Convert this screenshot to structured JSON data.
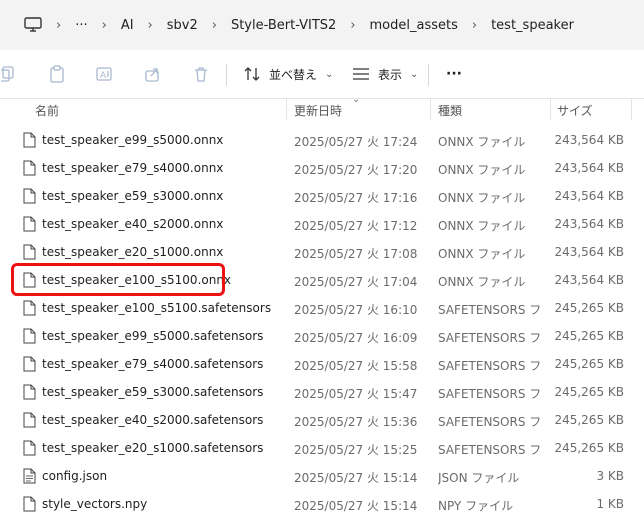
{
  "breadcrumb": {
    "items": [
      "AI",
      "sbv2",
      "Style-Bert-VITS2",
      "model_assets",
      "test_speaker"
    ],
    "more": "···"
  },
  "toolbar": {
    "sort_label": "並べ替え",
    "view_label": "表示",
    "more_label": "···"
  },
  "columns": {
    "name": "名前",
    "date": "更新日時",
    "type": "種類",
    "size": "サイズ"
  },
  "files": [
    {
      "name": "test_speaker_e99_s5000.onnx",
      "date": "2025/05/27 火 17:24",
      "type": "ONNX ファイル",
      "size": "243,564 KB"
    },
    {
      "name": "test_speaker_e79_s4000.onnx",
      "date": "2025/05/27 火 17:20",
      "type": "ONNX ファイル",
      "size": "243,564 KB"
    },
    {
      "name": "test_speaker_e59_s3000.onnx",
      "date": "2025/05/27 火 17:16",
      "type": "ONNX ファイル",
      "size": "243,564 KB"
    },
    {
      "name": "test_speaker_e40_s2000.onnx",
      "date": "2025/05/27 火 17:12",
      "type": "ONNX ファイル",
      "size": "243,564 KB"
    },
    {
      "name": "test_speaker_e20_s1000.onnx",
      "date": "2025/05/27 火 17:08",
      "type": "ONNX ファイル",
      "size": "243,564 KB"
    },
    {
      "name": "test_speaker_e100_s5100.onnx",
      "date": "2025/05/27 火 17:04",
      "type": "ONNX ファイル",
      "size": "243,564 KB"
    },
    {
      "name": "test_speaker_e100_s5100.safetensors",
      "date": "2025/05/27 火 16:10",
      "type": "SAFETENSORS ファ...",
      "size": "245,265 KB"
    },
    {
      "name": "test_speaker_e99_s5000.safetensors",
      "date": "2025/05/27 火 16:09",
      "type": "SAFETENSORS ファ...",
      "size": "245,265 KB"
    },
    {
      "name": "test_speaker_e79_s4000.safetensors",
      "date": "2025/05/27 火 15:58",
      "type": "SAFETENSORS ファ...",
      "size": "245,265 KB"
    },
    {
      "name": "test_speaker_e59_s3000.safetensors",
      "date": "2025/05/27 火 15:47",
      "type": "SAFETENSORS ファ...",
      "size": "245,265 KB"
    },
    {
      "name": "test_speaker_e40_s2000.safetensors",
      "date": "2025/05/27 火 15:36",
      "type": "SAFETENSORS ファ...",
      "size": "245,265 KB"
    },
    {
      "name": "test_speaker_e20_s1000.safetensors",
      "date": "2025/05/27 火 15:25",
      "type": "SAFETENSORS ファ...",
      "size": "245,265 KB"
    },
    {
      "name": "config.json",
      "date": "2025/05/27 火 15:14",
      "type": "JSON ファイル",
      "size": "3 KB"
    },
    {
      "name": "style_vectors.npy",
      "date": "2025/05/27 火 15:14",
      "type": "NPY ファイル",
      "size": "1 KB"
    }
  ],
  "highlight_color": "#ee1111"
}
